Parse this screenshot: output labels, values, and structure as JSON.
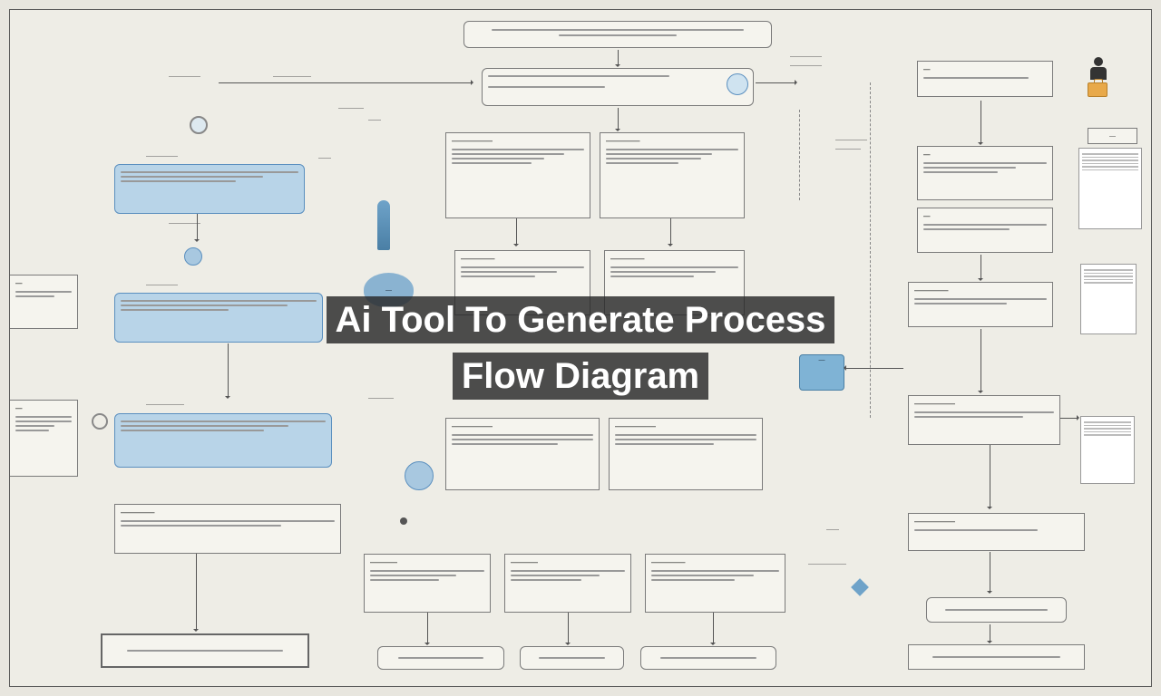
{
  "overlay": {
    "title": "Ai Tool To Generate Process Flow Diagram"
  },
  "nodes": {
    "top_long": "",
    "labels": {}
  }
}
